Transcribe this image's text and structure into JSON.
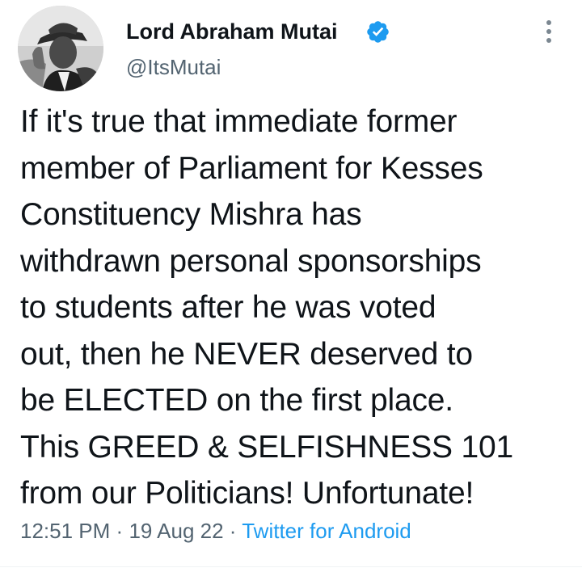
{
  "author": {
    "display_name": "Lord Abraham Mutai",
    "handle": "@ItsMutai",
    "verified_icon": "verified-badge-icon",
    "avatar_icon": "profile-photo"
  },
  "more_icon": "more-options-icon",
  "tweet": {
    "lines": [
      "If it's true that immediate former",
      "member of Parliament for Kesses",
      "Constituency Mishra has",
      "withdrawn personal sponsorships",
      "to students after he was voted",
      "out, then he NEVER deserved to",
      "be ELECTED on the first place.",
      "This GREED & SELFISHNESS 101",
      "from our Politicians! Unfortunate!"
    ]
  },
  "meta": {
    "time": "12:51 PM",
    "separator": "·",
    "date": "19 Aug 22",
    "source": "Twitter for Android"
  },
  "colors": {
    "text": "#0f1419",
    "secondary": "#536471",
    "accent": "#1d9bf0"
  }
}
